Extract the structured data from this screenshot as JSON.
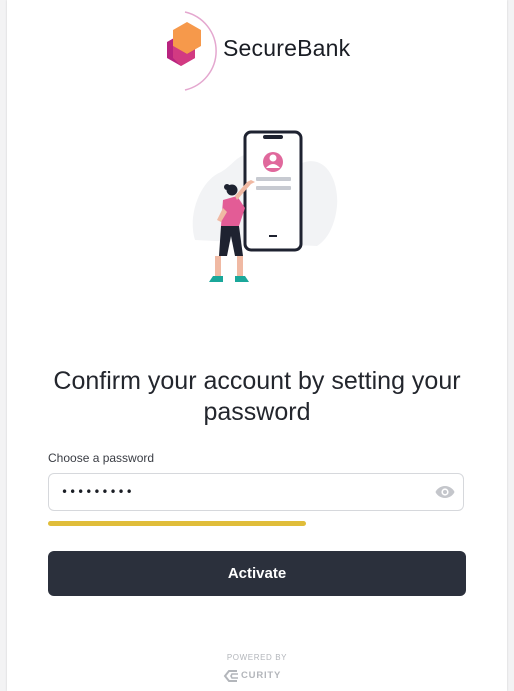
{
  "brand": {
    "name": "SecureBank",
    "colors": {
      "hex_top": "#f7a35c",
      "hex_bottom": "#c2268f",
      "ring": "#e4a7cf"
    }
  },
  "illustration": {
    "name": "person-with-phone-illustration"
  },
  "heading": "Confirm your account by setting your password",
  "password": {
    "label": "Choose a password",
    "value": "password1",
    "icon": "eye-icon",
    "strength": 0.62,
    "strength_color": "#e0bd3a"
  },
  "activate_button": {
    "label": "Activate",
    "color": "#2b303c"
  },
  "footer": {
    "powered_by": "POWERED BY",
    "vendor": "CURITY"
  }
}
